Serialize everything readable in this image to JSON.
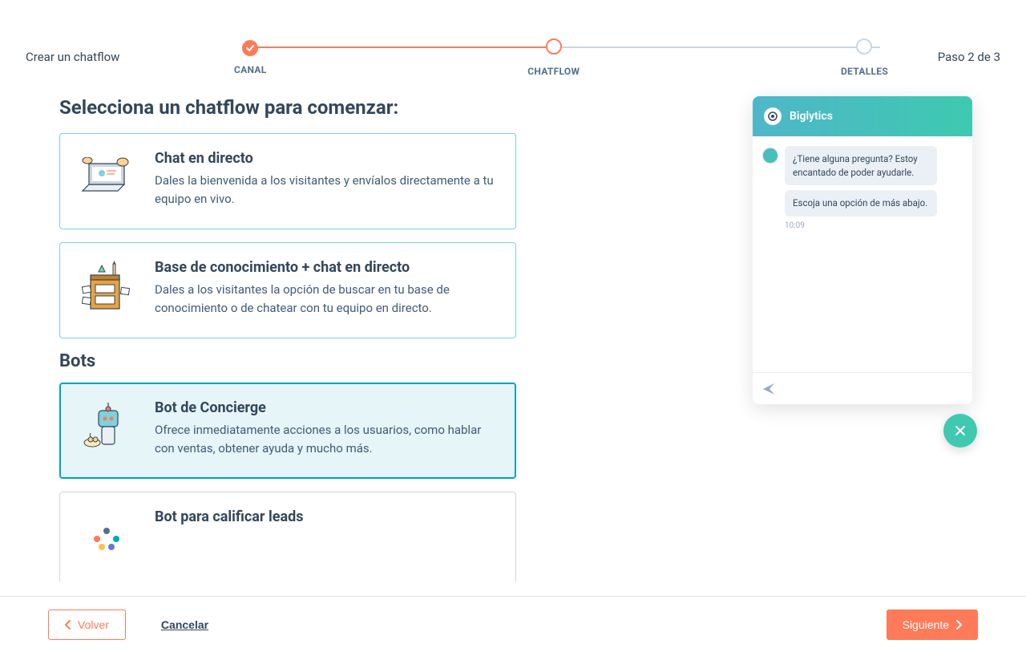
{
  "header": {
    "title": "Crear un chatflow",
    "step_text": "Paso 2 de 3"
  },
  "stepper": {
    "steps": [
      {
        "label": "CANAL"
      },
      {
        "label": "CHATFLOW"
      },
      {
        "label": "DETALLES"
      }
    ]
  },
  "page": {
    "heading": "Selecciona un chatflow para comenzar:"
  },
  "cards": [
    {
      "title": "Chat en directo",
      "desc": "Dales la bienvenida a los visitantes y envíalos directamente a tu equipo en vivo."
    },
    {
      "title": "Base de conocimiento + chat en directo",
      "desc": "Dales a los visitantes la opción de buscar en tu base de conocimiento o de chatear con tu equipo en directo."
    }
  ],
  "bots_heading": "Bots",
  "bot_cards": [
    {
      "title": "Bot de Concierge",
      "desc": "Ofrece inmediatamente acciones a los usuarios, como hablar con ventas, obtener ayuda y mucho más."
    },
    {
      "title": "Bot para calificar leads",
      "desc": ""
    }
  ],
  "chat": {
    "brand": "Biglytics",
    "messages": [
      "¿Tiene alguna pregunta? Estoy encantado de poder ayudarle.",
      "Escoja una opción de más abajo."
    ],
    "timestamp": "10:09"
  },
  "footer": {
    "back": "Volver",
    "cancel": "Cancelar",
    "next": "Siguiente"
  }
}
